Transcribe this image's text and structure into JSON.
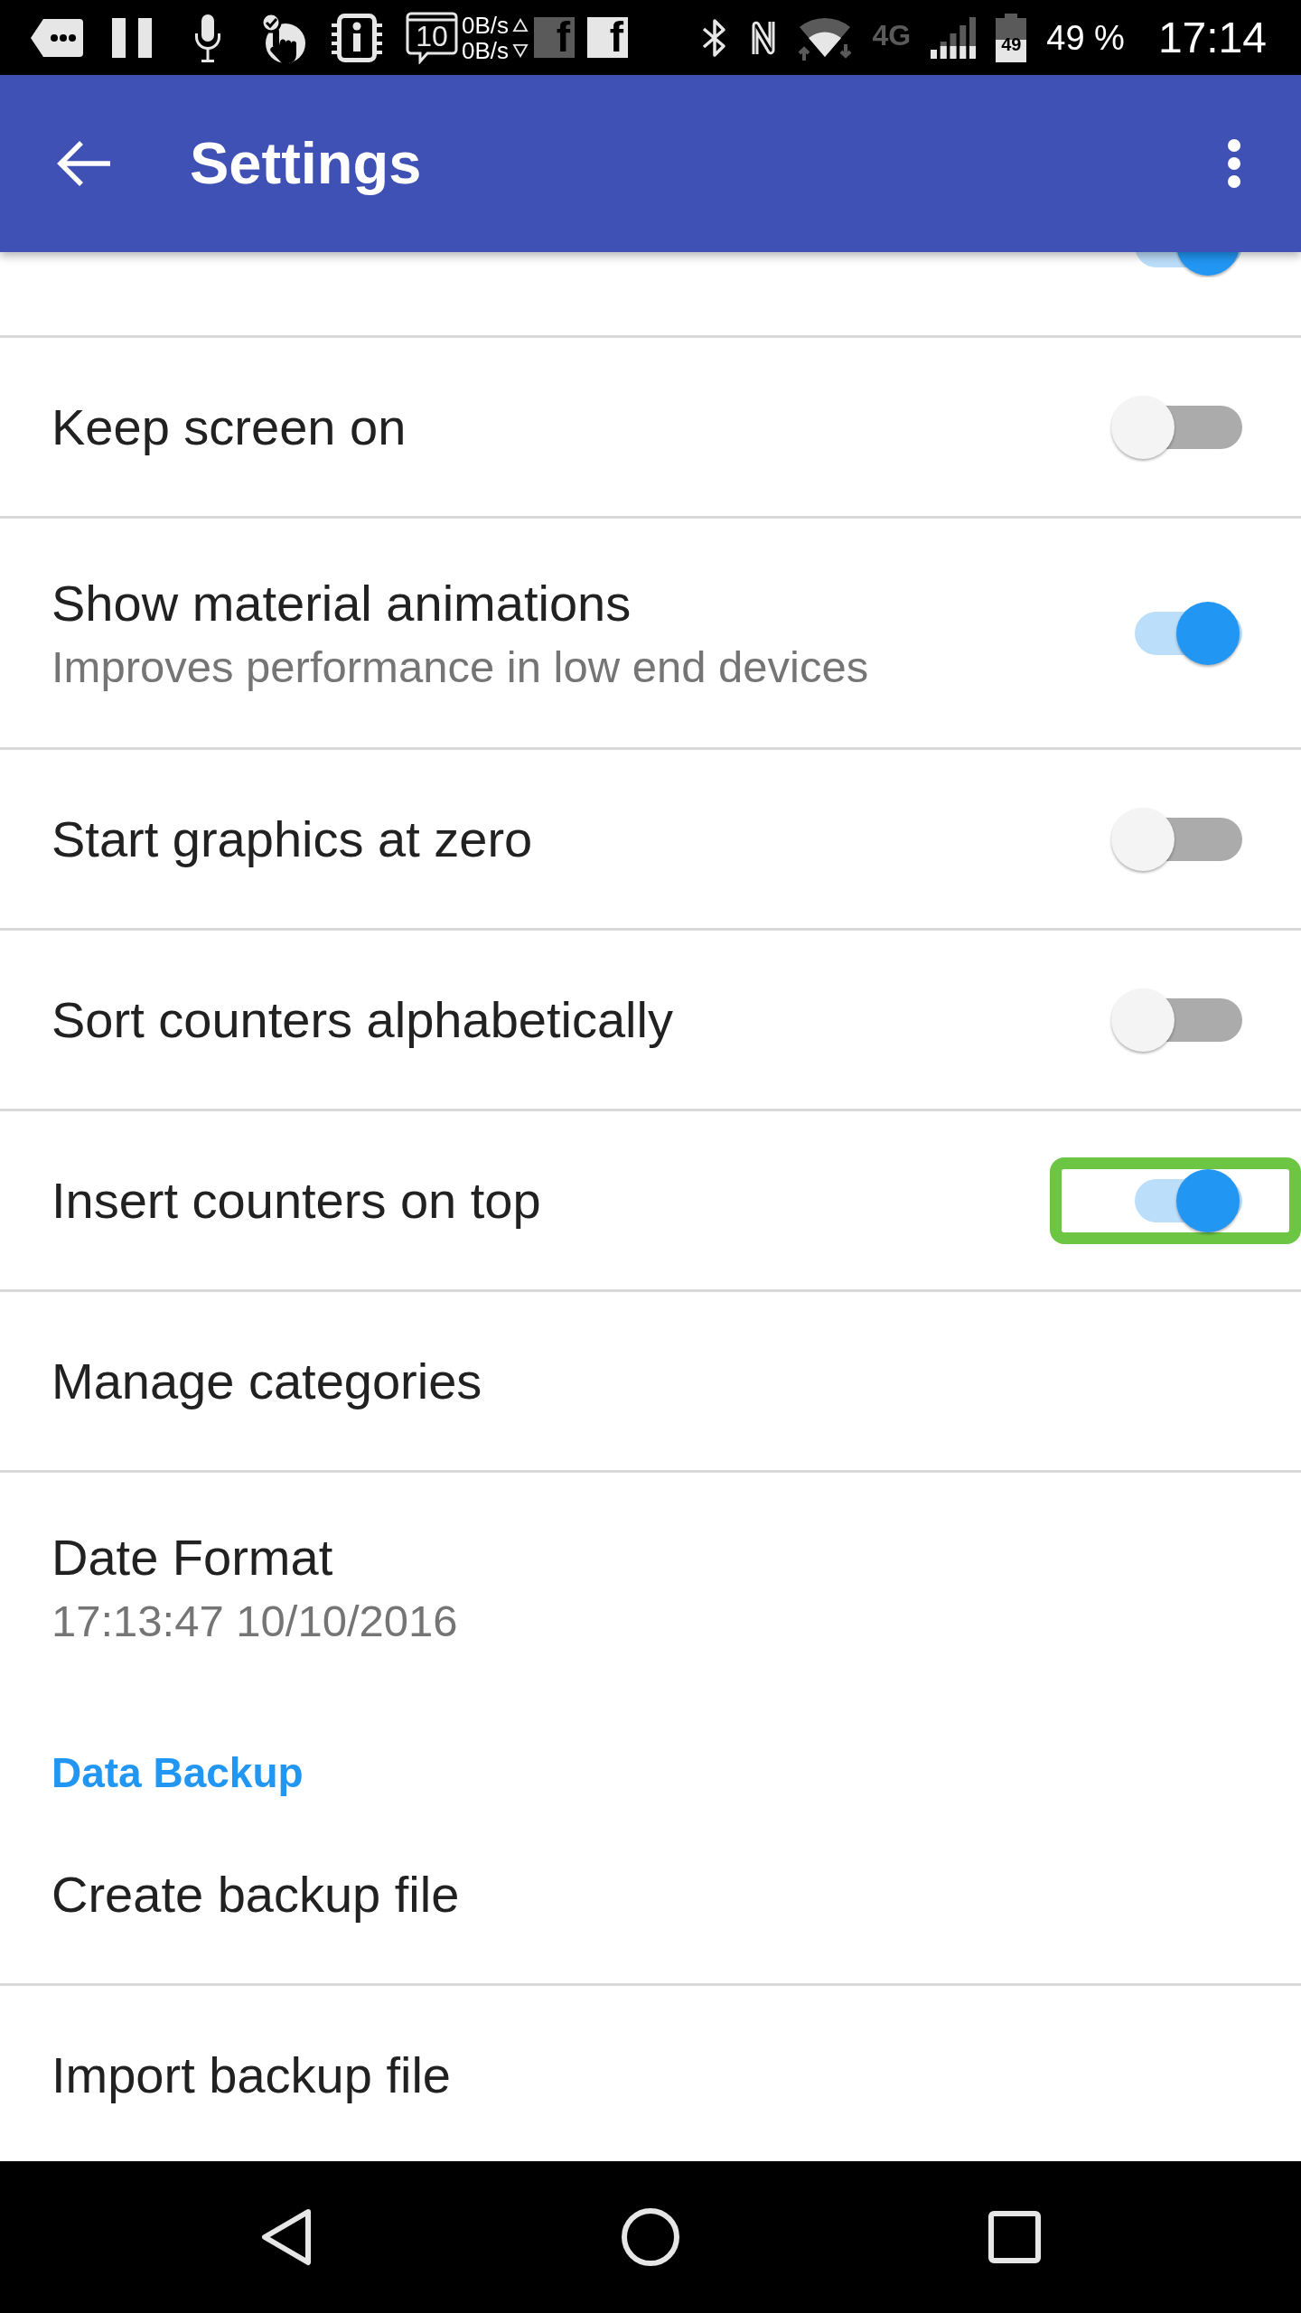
{
  "status_bar": {
    "notifications": [
      {
        "kind": "tag"
      },
      {
        "kind": "pause"
      },
      {
        "kind": "mic"
      },
      {
        "kind": "touch"
      },
      {
        "kind": "chip"
      },
      {
        "kind": "calendar",
        "text": "10"
      },
      {
        "kind": "netspeed",
        "up": "0B/s",
        "down": "0B/s",
        "logo_behind": "f"
      },
      {
        "kind": "logo",
        "text": "f"
      }
    ],
    "system": [
      {
        "kind": "bluetooth"
      },
      {
        "kind": "nfc"
      },
      {
        "kind": "wifi"
      },
      {
        "kind": "network",
        "text": "4G"
      },
      {
        "kind": "signal"
      },
      {
        "kind": "battery",
        "text": "49"
      }
    ],
    "battery_percent": "49 %",
    "clock": "17:14"
  },
  "app_bar": {
    "title": "Settings"
  },
  "settings": [
    {
      "kind": "partial",
      "on": true,
      "highlighted": false
    },
    {
      "kind": "switch",
      "title": "Keep screen on",
      "on": false,
      "highlighted": false
    },
    {
      "kind": "switch",
      "title": "Show material animations",
      "summary": "Improves performance in low end devices",
      "on": true,
      "highlighted": false
    },
    {
      "kind": "switch",
      "title": "Start graphics at zero",
      "on": false,
      "highlighted": false
    },
    {
      "kind": "switch",
      "title": "Sort counters alphabetically",
      "on": false,
      "highlighted": false
    },
    {
      "kind": "switch",
      "title": "Insert counters on top",
      "on": true,
      "highlighted": true
    },
    {
      "kind": "item",
      "title": "Manage categories"
    },
    {
      "kind": "item",
      "title": "Date Format",
      "summary": "17:13:47 10/10/2016"
    },
    {
      "kind": "category",
      "title": "Data Backup"
    },
    {
      "kind": "item",
      "title": "Create backup file"
    },
    {
      "kind": "item",
      "title": "Import backup file"
    }
  ]
}
